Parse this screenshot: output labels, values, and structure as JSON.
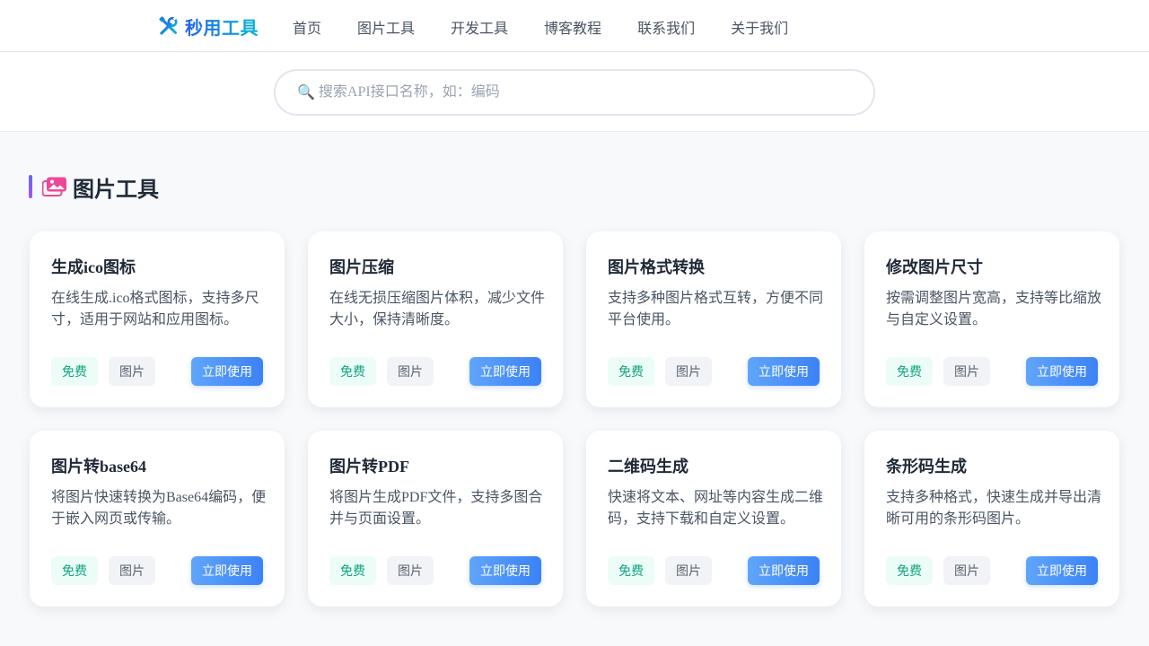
{
  "header": {
    "logo_text": "秒用工具",
    "nav": [
      "首页",
      "图片工具",
      "开发工具",
      "博客教程",
      "联系我们",
      "关于我们"
    ]
  },
  "search": {
    "placeholder": "搜索API接口名称，如：编码"
  },
  "section": {
    "title": "图片工具"
  },
  "cards": [
    {
      "title": "生成ico图标",
      "desc": "在线生成.ico格式图标，支持多尺寸，适用于网站和应用图标。",
      "tag_free": "免费",
      "tag_category": "图片",
      "button": "立即使用"
    },
    {
      "title": "图片压缩",
      "desc": "在线无损压缩图片体积，减少文件大小，保持清晰度。",
      "tag_free": "免费",
      "tag_category": "图片",
      "button": "立即使用"
    },
    {
      "title": "图片格式转换",
      "desc": "支持多种图片格式互转，方便不同平台使用。",
      "tag_free": "免费",
      "tag_category": "图片",
      "button": "立即使用"
    },
    {
      "title": "修改图片尺寸",
      "desc": "按需调整图片宽高，支持等比缩放与自定义设置。",
      "tag_free": "免费",
      "tag_category": "图片",
      "button": "立即使用"
    },
    {
      "title": "图片转base64",
      "desc": "将图片快速转换为Base64编码，便于嵌入网页或传输。",
      "tag_free": "免费",
      "tag_category": "图片",
      "button": "立即使用"
    },
    {
      "title": "图片转PDF",
      "desc": "将图片生成PDF文件，支持多图合并与页面设置。",
      "tag_free": "免费",
      "tag_category": "图片",
      "button": "立即使用"
    },
    {
      "title": "二维码生成",
      "desc": "快速将文本、网址等内容生成二维码，支持下载和自定义设置。",
      "tag_free": "免费",
      "tag_category": "图片",
      "button": "立即使用"
    },
    {
      "title": "条形码生成",
      "desc": "支持多种格式，快速生成并导出清晰可用的条形码图片。",
      "tag_free": "免费",
      "tag_category": "图片",
      "button": "立即使用"
    }
  ],
  "icons": {
    "logo": "tools-icon",
    "search": "magnifier-icon",
    "section": "images-icon"
  },
  "colors": {
    "brand_gradient_start": "#2563eb",
    "brand_gradient_end": "#06b6d4",
    "button": "#3b82f6",
    "free_tag": "#10a37f",
    "section_icon": "#ec4899"
  }
}
